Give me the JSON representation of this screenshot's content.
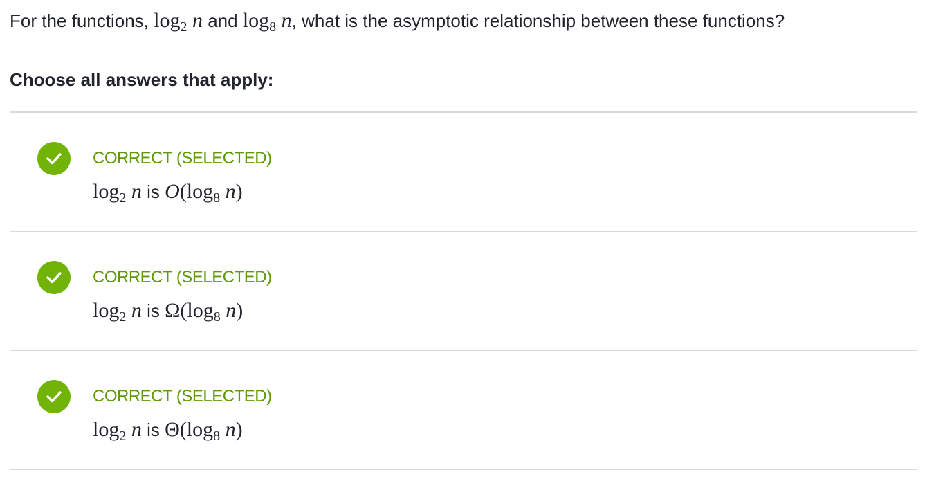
{
  "question": {
    "prefix": "For the functions,",
    "f1_log": "log",
    "f1_base": "2",
    "f1_var": "n",
    "and": "and",
    "f2_log": "log",
    "f2_base": "8",
    "f2_var": "n",
    "suffix": ", what is the asymptotic relationship between these functions?"
  },
  "instruction": "Choose all answers that apply:",
  "choices": [
    {
      "status": "CORRECT (SELECTED)",
      "lhs_log": "log",
      "lhs_base": "2",
      "lhs_var": "n",
      "is": "is",
      "notation": "O",
      "rhs_open": "(",
      "rhs_log": "log",
      "rhs_base": "8",
      "rhs_var": "n",
      "rhs_close": ")",
      "icon": "check-circle-icon"
    },
    {
      "status": "CORRECT (SELECTED)",
      "lhs_log": "log",
      "lhs_base": "2",
      "lhs_var": "n",
      "is": "is",
      "notation": "Ω",
      "rhs_open": "(",
      "rhs_log": "log",
      "rhs_base": "8",
      "rhs_var": "n",
      "rhs_close": ")",
      "icon": "check-circle-icon"
    },
    {
      "status": "CORRECT (SELECTED)",
      "lhs_log": "log",
      "lhs_base": "2",
      "lhs_var": "n",
      "is": "is",
      "notation": "Θ",
      "rhs_open": "(",
      "rhs_log": "log",
      "rhs_base": "8",
      "rhs_var": "n",
      "rhs_close": ")",
      "icon": "check-circle-icon"
    }
  ],
  "colors": {
    "correct_green": "#71b307",
    "status_text": "#5f9a0a",
    "divider": "#d6d8da",
    "text": "#21242c"
  }
}
